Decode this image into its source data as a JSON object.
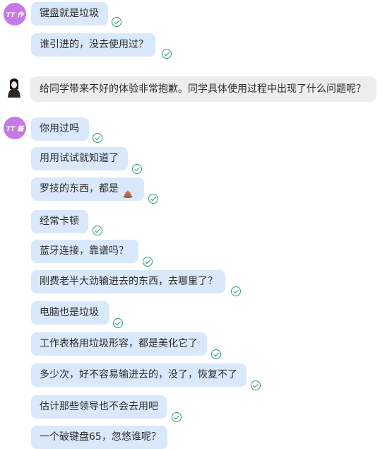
{
  "chat": {
    "user_avatar_label": "TT 作",
    "user_avatar_label_2": "TT 酱",
    "group1": [
      "键盘就是垃圾",
      "谁引进的，没去使用过？"
    ],
    "agent_message": "给同学带来不好的体验非常抱歉。同学具体使用过程中出现了什么问题呢？",
    "group2": [
      "你用过吗",
      "用用试试就知道了",
      "罗技的东西，都是",
      "经常卡顿",
      "蓝牙连接，靠谱吗？",
      "刚费老半大劲输进去的东西，去哪里了？",
      "电脑也是垃圾",
      "工作表格用垃圾形容，都是美化它了",
      "多少次，好不容易输进去的，没了，恢复不了",
      "估计那些领导也不会去用吧",
      "一个破键盘65，忽悠谁呢？"
    ],
    "emoji_names": [
      "poop-emoji"
    ],
    "colors": {
      "user_bubble": "#d9e8fb",
      "agent_bubble": "#ededed",
      "check": "#2e9b74",
      "avatar": "#c779e6"
    }
  }
}
